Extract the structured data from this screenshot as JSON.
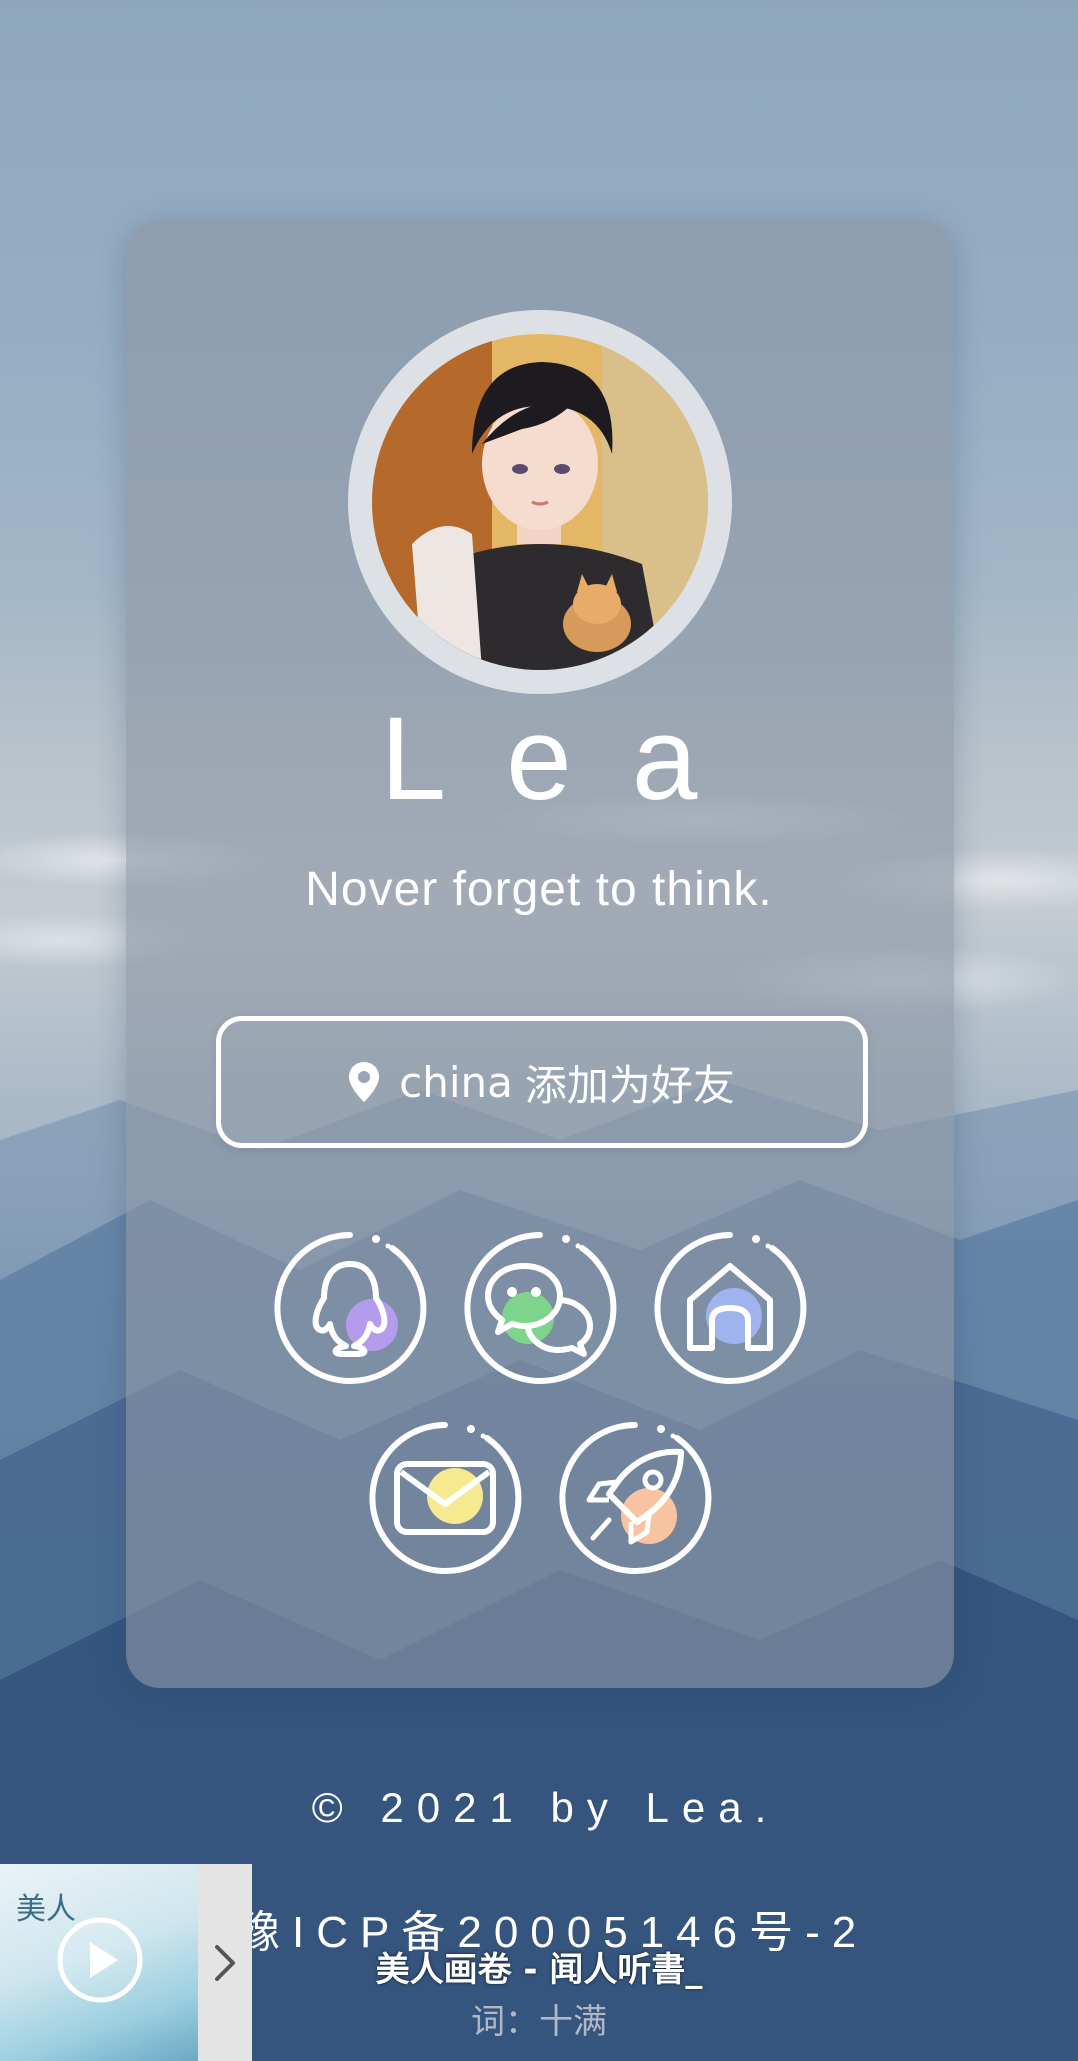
{
  "profile": {
    "name": "Lea",
    "motto": "Nover forget to think."
  },
  "friend_button": {
    "location": "china",
    "label": "添加为好友",
    "icon": "location-pin-icon"
  },
  "social_links": [
    {
      "name": "qq",
      "icon": "qq-icon",
      "accent": "#b39ceb"
    },
    {
      "name": "wechat",
      "icon": "wechat-icon",
      "accent": "#7fd48c"
    },
    {
      "name": "home",
      "icon": "home-icon",
      "accent": "#9fb4ef"
    },
    {
      "name": "email",
      "icon": "email-icon",
      "accent": "#f5ea8f"
    },
    {
      "name": "rocket",
      "icon": "rocket-icon",
      "accent": "#f8c3a0"
    }
  ],
  "footer": {
    "copyright": "© 2021 by Lea.",
    "icp": "豫ICP备20005146号-2"
  },
  "player": {
    "cover_text": "美人",
    "song": "美人画卷 - 闻人听書_",
    "lyric": "词：十满"
  }
}
